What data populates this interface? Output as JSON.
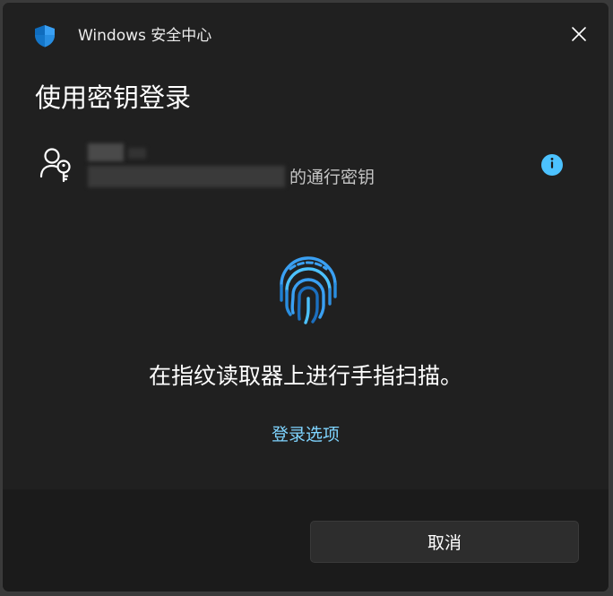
{
  "window": {
    "app_title": "Windows 安全中心",
    "shield_icon": "windows-security-shield-icon",
    "close_icon": "close-icon"
  },
  "heading": "使用密钥登录",
  "account": {
    "icon": "person-key-icon",
    "suffix": "的通行密钥",
    "info_icon": "info-icon"
  },
  "fingerprint_icon": "fingerprint-icon",
  "instruction": "在指纹读取器上进行手指扫描。",
  "sign_in_options_label": "登录选项",
  "cancel_label": "取消",
  "colors": {
    "accent": "#4cc2ff",
    "link": "#7fd4ff",
    "background": "#202020",
    "footer": "#1b1b1b"
  }
}
